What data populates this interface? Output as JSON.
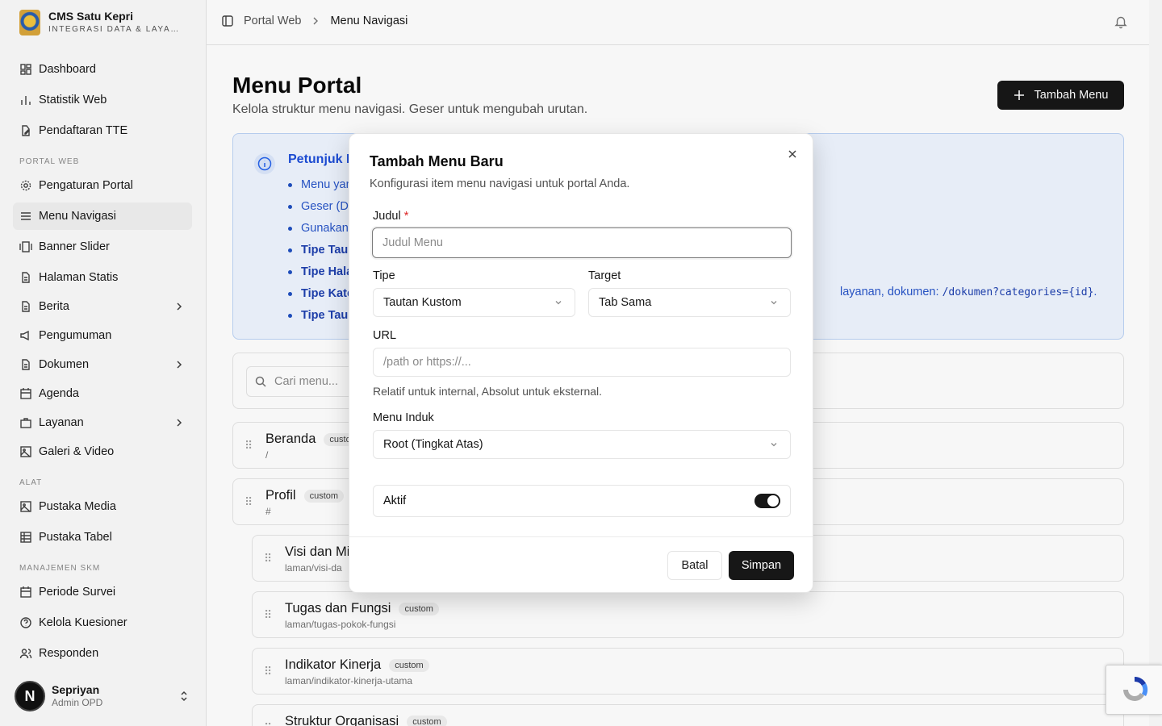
{
  "brand": {
    "title": "CMS Satu Kepri",
    "subtitle": "INTEGRASI DATA & LAYANAN"
  },
  "sidebar": {
    "items": [
      {
        "label": "Dashboard",
        "icon": "dashboard-icon"
      },
      {
        "label": "Statistik Web",
        "icon": "bar-chart-icon"
      },
      {
        "label": "Pendaftaran TTE",
        "icon": "file-pen-icon"
      },
      {
        "label": "Pengaturan Portal",
        "icon": "gear-icon"
      },
      {
        "label": "Menu Navigasi",
        "icon": "menu-icon"
      },
      {
        "label": "Banner Slider",
        "icon": "gallery-icon"
      },
      {
        "label": "Halaman Statis",
        "icon": "file-icon"
      },
      {
        "label": "Berita",
        "icon": "file-icon"
      },
      {
        "label": "Pengumuman",
        "icon": "megaphone-icon"
      },
      {
        "label": "Dokumen",
        "icon": "file-icon"
      },
      {
        "label": "Agenda",
        "icon": "calendar-icon"
      },
      {
        "label": "Layanan",
        "icon": "briefcase-icon"
      },
      {
        "label": "Galeri & Video",
        "icon": "image-icon"
      },
      {
        "label": "Pustaka Media",
        "icon": "image-icon"
      },
      {
        "label": "Pustaka Tabel",
        "icon": "table-icon"
      },
      {
        "label": "Periode Survei",
        "icon": "calendar-icon"
      },
      {
        "label": "Kelola Kuesioner",
        "icon": "help-circle-icon"
      },
      {
        "label": "Responden",
        "icon": "users-icon"
      }
    ],
    "sections": {
      "portal_web": "PORTAL WEB",
      "alat": "ALAT",
      "manajemen_skm": "MANAJEMEN SKM"
    }
  },
  "user": {
    "initial": "N",
    "name": "Sepriyan",
    "role": "Admin OPD"
  },
  "breadcrumb": {
    "parent": "Portal Web",
    "current": "Menu Navigasi"
  },
  "page": {
    "title": "Menu Portal",
    "description": "Kelola struktur menu navigasi. Geser untuk mengubah urutan.",
    "add_button": "Tambah Menu"
  },
  "info": {
    "title": "Petunjuk M",
    "items": [
      "Menu yan",
      "Geser (D",
      "Gunakan"
    ],
    "bold_items": [
      "Tipe Tau",
      "Tipe Hala",
      "Tipe Kate",
      "Tipe Tau"
    ],
    "tail_text": "layanan, dokumen: ",
    "tail_code": "/dokumen?categories={id}",
    "tail_end": "."
  },
  "search": {
    "placeholder": "Cari menu..."
  },
  "menu_rows": [
    {
      "title": "Beranda",
      "badge": "custo",
      "path": "/"
    },
    {
      "title": "Profil",
      "badge": "custom",
      "path": "#"
    },
    {
      "title": "Visi dan Mi",
      "badge": "",
      "path": "laman/visi-da"
    },
    {
      "title": "Tugas dan Fungsi",
      "badge": "custom",
      "path": "laman/tugas-pokok-fungsi"
    },
    {
      "title": "Indikator Kinerja",
      "badge": "custom",
      "path": "laman/indikator-kinerja-utama"
    },
    {
      "title": "Struktur Organisasi",
      "badge": "custom",
      "path": ""
    }
  ],
  "modal": {
    "title": "Tambah Menu Baru",
    "description": "Konfigurasi item menu navigasi untuk portal Anda.",
    "title_label": "Judul",
    "required_mark": "*",
    "title_placeholder": "Judul Menu",
    "type_label": "Tipe",
    "type_value": "Tautan Kustom",
    "target_label": "Target",
    "target_value": "Tab Sama",
    "url_label": "URL",
    "url_placeholder": "/path or https://...",
    "url_hint": "Relatif untuk internal, Absolut untuk eksternal.",
    "parent_label": "Menu Induk",
    "parent_value": "Root (Tingkat Atas)",
    "active_label": "Aktif",
    "active_on": true,
    "cancel_label": "Batal",
    "save_label": "Simpan"
  }
}
